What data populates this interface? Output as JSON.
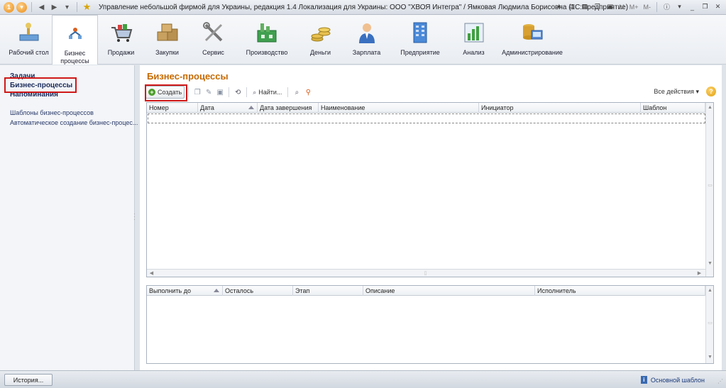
{
  "window": {
    "title": "Управление небольшой фирмой для Украины, редакция 1.4 Локализация для Украины: ООО \"ХВОЯ Интегра\" / Ямковая Людмила Борисовна  (1С:Предприятие)",
    "m_label": "M",
    "mplus_label": "M+",
    "mminus_label": "M-"
  },
  "sections": [
    {
      "label": "Рабочий стол",
      "icon": "desktop-icon"
    },
    {
      "label": "Бизнес процессы",
      "icon": "business-process-icon",
      "active": true
    },
    {
      "label": "Продажи",
      "icon": "sales-cart-icon"
    },
    {
      "label": "Закупки",
      "icon": "purchases-boxes-icon"
    },
    {
      "label": "Сервис",
      "icon": "service-tools-icon"
    },
    {
      "label": "Производство",
      "icon": "production-factory-icon"
    },
    {
      "label": "Деньги",
      "icon": "money-coins-icon"
    },
    {
      "label": "Зарплата",
      "icon": "salary-person-icon"
    },
    {
      "label": "Предприятие",
      "icon": "enterprise-building-icon"
    },
    {
      "label": "Анализ",
      "icon": "analysis-chart-icon"
    },
    {
      "label": "Администрирование",
      "icon": "administration-icon"
    }
  ],
  "leftnav": {
    "tasks": "Задачи",
    "business_processes": "Бизнес-процессы",
    "reminders": "Напоминания",
    "link_templates": "Шаблоны бизнес-процессов",
    "link_auto": "Автоматическое создание бизнес-процес..."
  },
  "main": {
    "title": "Бизнес-процессы",
    "create_label": "Создать",
    "find_label": "Найти...",
    "all_actions": "Все действия ▾",
    "help": "?"
  },
  "top_table": {
    "columns": [
      "Номер",
      "Дата",
      "Дата завершения",
      "Наименование",
      "Инициатор",
      "Шаблон"
    ],
    "rows": []
  },
  "bottom_table": {
    "columns": [
      "Выполнить до",
      "Осталось",
      "Этап",
      "Описание",
      "Исполнитель"
    ],
    "rows": []
  },
  "statusbar": {
    "history": "История...",
    "template": "Основной шаблон"
  },
  "colors": {
    "title_orange": "#c56a00",
    "highlight_red": "#d01818",
    "nav_text": "#1a2a5a"
  }
}
